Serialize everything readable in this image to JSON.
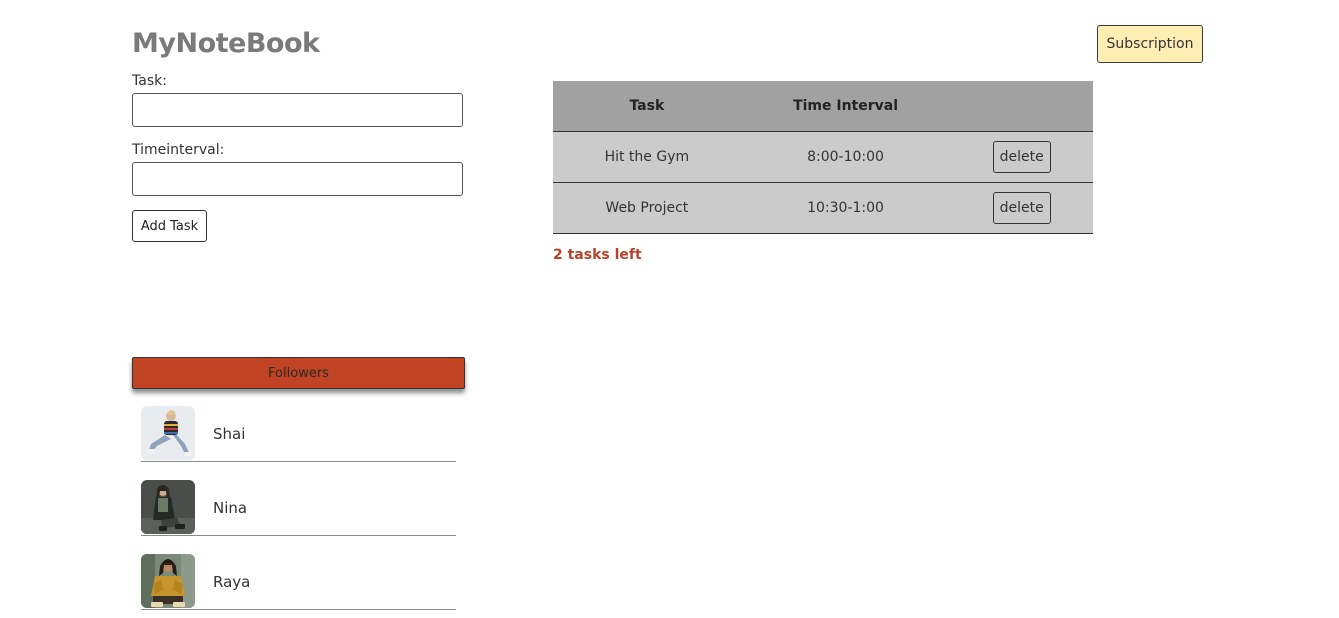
{
  "header": {
    "logo": "MyNoteBook",
    "subscription_label": "Subscription"
  },
  "form": {
    "task_label": "Task:",
    "task_value": "",
    "time_label": "Timeinterval:",
    "time_value": "",
    "add_label": "Add Task"
  },
  "table": {
    "headers": [
      "Task",
      "Time Interval",
      ""
    ],
    "rows": [
      {
        "task": "Hit the Gym",
        "time": "8:00-10:00",
        "action": "delete"
      },
      {
        "task": "Web Project",
        "time": "10:30-1:00",
        "action": "delete"
      }
    ]
  },
  "status": {
    "tasks_left": "2 tasks left"
  },
  "followers": {
    "button_label": "Followers",
    "items": [
      {
        "name": "Shai"
      },
      {
        "name": "Nina"
      },
      {
        "name": "Raya"
      }
    ]
  },
  "colors": {
    "accent": "#c04323",
    "subscription_bg": "#ffeeb4",
    "table_header": "#a1a1a1",
    "table_row": "#cbcbcb",
    "tasks_left": "#b5432a"
  }
}
